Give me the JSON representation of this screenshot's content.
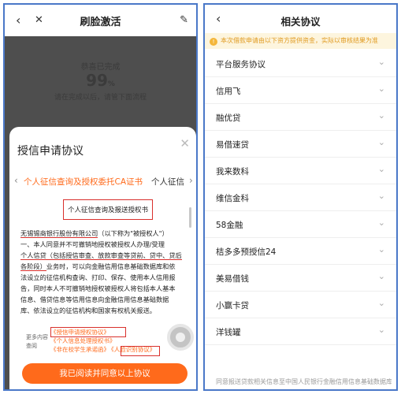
{
  "left": {
    "nav": {
      "title": "刷脸激活",
      "back_icon": "‹",
      "close_icon": "✕",
      "edit_icon": "✎"
    },
    "bg": {
      "line1": "恭喜已完成",
      "percent": "99",
      "percent_unit": "%",
      "line3": "请在完成以后，请管下面流程"
    },
    "sheet": {
      "title": "授信申请协议",
      "close_icon": "✕",
      "tab_prev_icon": "‹",
      "tab_active": "个人征信查询及授权委托CA证书",
      "tab_next": "个人征信",
      "tab_next_icon": "›",
      "doc_title": "个人征信查询及报送授权书",
      "para_lines": [
        {
          "u": "无锡锡商银行股份有限公司",
          "t": "（以下称为\"被授权人\"）"
        },
        {
          "u": "",
          "t": "一、本人同意并不可撤销地授权被授权人办理/受理 "
        },
        {
          "u": "个人信贷（包括授信审查、放款审查等贷前、贷中、贷后",
          "t": ""
        },
        {
          "u": "各阶段）",
          "t": "业务时，可以向金融信用信息基础数据库和依"
        },
        {
          "u": "",
          "t": "法设立的征信机构查询、打印、保存、使用本人信用报"
        },
        {
          "u": "",
          "t": "告，同时本人不可撤销地授权被授权人将包括本人基本"
        },
        {
          "u": "",
          "t": "信息、借贷信息等信用信息向金融信用信息基础数据"
        },
        {
          "u": "",
          "t": "库、依法设立的征信机构和国家有权机关报送。"
        }
      ],
      "more_label": "更多内容查阅",
      "links": [
        "《授信申请授权协议》",
        "《个人信息处理授权书》",
        "《非在校学生承诺函》",
        "《人脸识别协议》"
      ],
      "agree_button": "我已阅读并同意以上协议"
    }
  },
  "right": {
    "nav": {
      "title": "相关协议",
      "back_icon": "‹"
    },
    "notice": "本次借款申请由以下资方提供资金，实际以审核结果为准",
    "notice_icon": "!",
    "chevron": "⌄",
    "items": [
      "平台服务协议",
      "信用飞",
      "融优贷",
      "易借速贷",
      "我来数科",
      "维信金科",
      "58金融",
      "桔多多预授信24",
      "美易借钱",
      "小赢卡贷",
      "洋钱罐"
    ],
    "footer": "同意报送贷款相关信息至中国人民银行金融信用信息基础数据库"
  },
  "colors": {
    "accent": "#ff6a1b",
    "highlight": "#d9302c",
    "frame": "#4a78c8"
  }
}
